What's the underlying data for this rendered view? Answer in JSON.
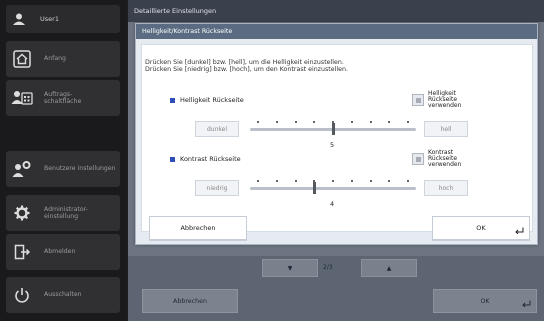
{
  "sidebar": {
    "user_label": "User1",
    "items": [
      {
        "label": "Anfang",
        "icon": "home-icon"
      },
      {
        "label": "Auftrags-\nschaltfläche",
        "icon": "job-button-icon"
      },
      {
        "label": "Benutzere instellungen",
        "icon": "user-settings-icon"
      },
      {
        "label": "Administrator-\neinstellung",
        "icon": "admin-gear-icon"
      },
      {
        "label": "Abmelden",
        "icon": "logout-icon"
      },
      {
        "label": "Ausschalten",
        "icon": "power-icon"
      }
    ]
  },
  "main": {
    "header": "Detaillierte Einstellungen",
    "page_indicator": "2/3",
    "cancel_label": "Abbrechen",
    "ok_label": "OK"
  },
  "dialog": {
    "title": "Helligkeit/Kontrast Rückseite",
    "description_line1": "Drücken Sie [dunkel] bzw. [hell], um die Helligkeit einzustellen.",
    "description_line2": "Drücken Sie [niedrig] bzw. [hoch], um den Kontrast einzustellen.",
    "brightness": {
      "label": "Helligkeit Rückseite",
      "checkbox_label": "Helligkeit\nRückseite\nverwenden",
      "min_label": "dunkel",
      "max_label": "hell",
      "value": "5",
      "level": 5,
      "steps": 9
    },
    "contrast": {
      "label": "Kontrast Rückseite",
      "checkbox_label": "Kontrast\nRückseite\nverwenden",
      "min_label": "niedrig",
      "max_label": "hoch",
      "value": "4",
      "level": 4,
      "steps": 9
    },
    "cancel_label": "Abbrechen",
    "ok_label": "OK"
  },
  "colors": {
    "accent_bullet": "#2f4fb8",
    "dialog_title_bg": "#5b6c82",
    "sidebar_bg": "#1a1a1c"
  }
}
